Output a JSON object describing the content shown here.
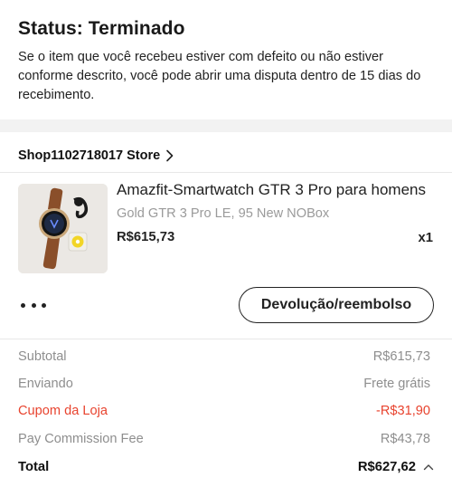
{
  "status": {
    "title": "Status: Terminado",
    "description": "Se o item que você recebeu estiver com defeito ou não estiver conforme descrito, você pode abrir uma disputa dentro de 15 dias do recebimento."
  },
  "store": {
    "name": "Shop1102718017 Store",
    "chevron_icon": "chevron-right-icon"
  },
  "product": {
    "title": "Amazfit-Smartwatch GTR 3 Pro para homens",
    "variant": "Gold GTR 3 Pro LE, 95 New NOBox",
    "price": "R$615,73",
    "quantity": "x1",
    "image_icon": "smartwatch-product-image"
  },
  "actions": {
    "more_icon": "more-options-icon",
    "refund_label": "Devolução/reembolso"
  },
  "summary": {
    "subtotal_label": "Subtotal",
    "subtotal_value": "R$615,73",
    "shipping_label": "Enviando",
    "shipping_value": "Frete grátis",
    "coupon_label": "Cupom da Loja",
    "coupon_value": "-R$31,90",
    "fee_label": "Pay Commission Fee",
    "fee_value": "R$43,78",
    "total_label": "Total",
    "total_value": "R$627,62",
    "total_toggle_icon": "chevron-up-icon"
  },
  "colors": {
    "accent_red": "#e8432e",
    "muted_text": "#8e8e8e",
    "background": "#f2f2f2"
  }
}
